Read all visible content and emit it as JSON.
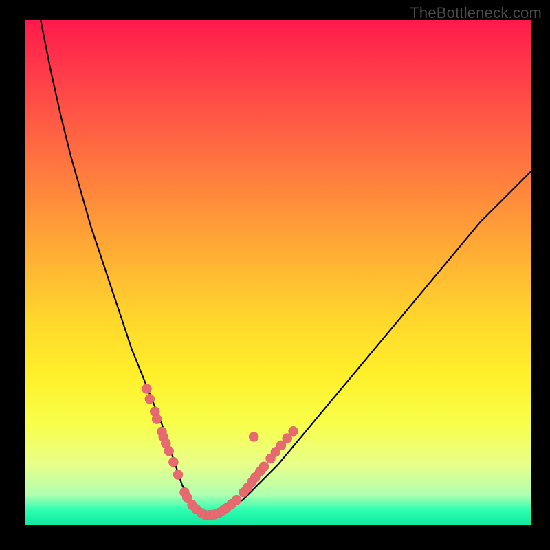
{
  "watermark": "TheBottleneck.com",
  "colors": {
    "frame": "#000000",
    "curve": "#000000",
    "marker_fill": "#e66a6f",
    "marker_stroke": "#d85a60"
  },
  "chart_data": {
    "type": "line",
    "title": "",
    "xlabel": "",
    "ylabel": "",
    "xlim": [
      0,
      100
    ],
    "ylim": [
      0,
      100
    ],
    "grid": false,
    "legend": false,
    "annotations": [
      "TheBottleneck.com"
    ],
    "series": [
      {
        "name": "bottleneck-curve",
        "x": [
          3,
          5,
          7,
          9,
          11,
          13,
          15,
          17,
          19,
          21,
          23,
          25,
          27,
          29,
          30,
          31,
          32,
          33,
          34,
          35,
          36,
          38,
          40,
          43,
          46,
          50,
          55,
          60,
          65,
          70,
          75,
          80,
          85,
          90,
          95,
          100
        ],
        "y": [
          100,
          90,
          81,
          73,
          66,
          59,
          53,
          47,
          41,
          35,
          30,
          25,
          20,
          14,
          11,
          8,
          6,
          4,
          3,
          2.2,
          2,
          2.3,
          3.2,
          5,
          8,
          12,
          18,
          24,
          30,
          36,
          42,
          48,
          54,
          60,
          65,
          70
        ]
      }
    ],
    "markers": [
      {
        "name": "cluster-left",
        "points": [
          {
            "x": 24.0,
            "y": 27.0
          },
          {
            "x": 24.6,
            "y": 25.0
          },
          {
            "x": 25.6,
            "y": 22.5
          },
          {
            "x": 26.0,
            "y": 21.0
          },
          {
            "x": 27.0,
            "y": 18.5
          },
          {
            "x": 27.3,
            "y": 17.5
          },
          {
            "x": 27.8,
            "y": 16.2
          },
          {
            "x": 28.4,
            "y": 14.7
          },
          {
            "x": 29.3,
            "y": 12.5
          },
          {
            "x": 30.2,
            "y": 10.0
          }
        ]
      },
      {
        "name": "cluster-bottom",
        "points": [
          {
            "x": 31.5,
            "y": 6.5
          },
          {
            "x": 32.0,
            "y": 5.5
          },
          {
            "x": 33.0,
            "y": 4.0
          },
          {
            "x": 33.8,
            "y": 3.2
          },
          {
            "x": 34.8,
            "y": 2.4
          },
          {
            "x": 35.6,
            "y": 2.0
          },
          {
            "x": 36.5,
            "y": 2.0
          },
          {
            "x": 37.3,
            "y": 2.1
          },
          {
            "x": 38.2,
            "y": 2.4
          },
          {
            "x": 39.0,
            "y": 2.9
          },
          {
            "x": 39.8,
            "y": 3.4
          },
          {
            "x": 40.8,
            "y": 4.2
          },
          {
            "x": 41.8,
            "y": 5.0
          }
        ]
      },
      {
        "name": "cluster-right",
        "points": [
          {
            "x": 43.2,
            "y": 6.5
          },
          {
            "x": 44.0,
            "y": 7.5
          },
          {
            "x": 44.8,
            "y": 8.5
          },
          {
            "x": 45.5,
            "y": 9.5
          },
          {
            "x": 46.4,
            "y": 10.6
          },
          {
            "x": 47.2,
            "y": 11.6
          },
          {
            "x": 48.5,
            "y": 13.2
          },
          {
            "x": 49.5,
            "y": 14.5
          },
          {
            "x": 50.6,
            "y": 15.8
          },
          {
            "x": 51.8,
            "y": 17.2
          },
          {
            "x": 53.0,
            "y": 18.6
          }
        ]
      },
      {
        "name": "outlier",
        "points": [
          {
            "x": 45.2,
            "y": 17.5
          }
        ]
      }
    ]
  }
}
